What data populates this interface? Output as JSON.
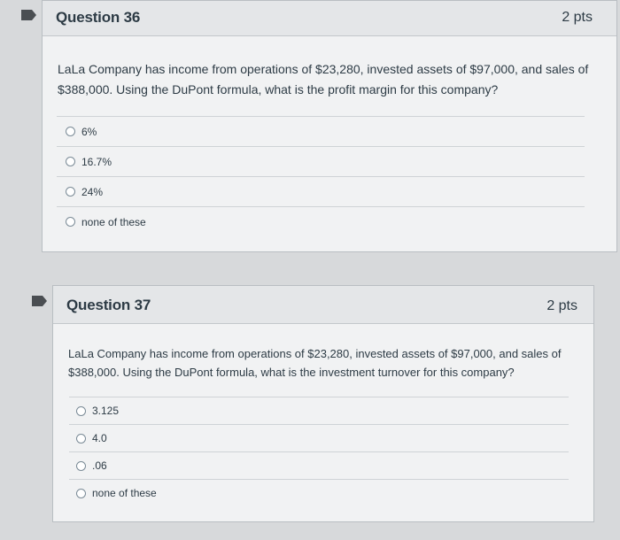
{
  "questions": [
    {
      "title": "Question 36",
      "points": "2 pts",
      "text": "LaLa Company has income from operations of $23,280, invested assets of $97,000, and sales of $388,000. Using the DuPont formula, what is the profit margin for this company?",
      "answers": [
        "6%",
        "16.7%",
        "24%",
        "none of these"
      ]
    },
    {
      "title": "Question 37",
      "points": "2 pts",
      "text": "LaLa Company has income from operations of $23,280, invested assets of $97,000, and sales of $388,000. Using the DuPont formula, what is the investment turnover for this company?",
      "answers": [
        "3.125",
        "4.0",
        ".06",
        "none of these"
      ]
    }
  ]
}
